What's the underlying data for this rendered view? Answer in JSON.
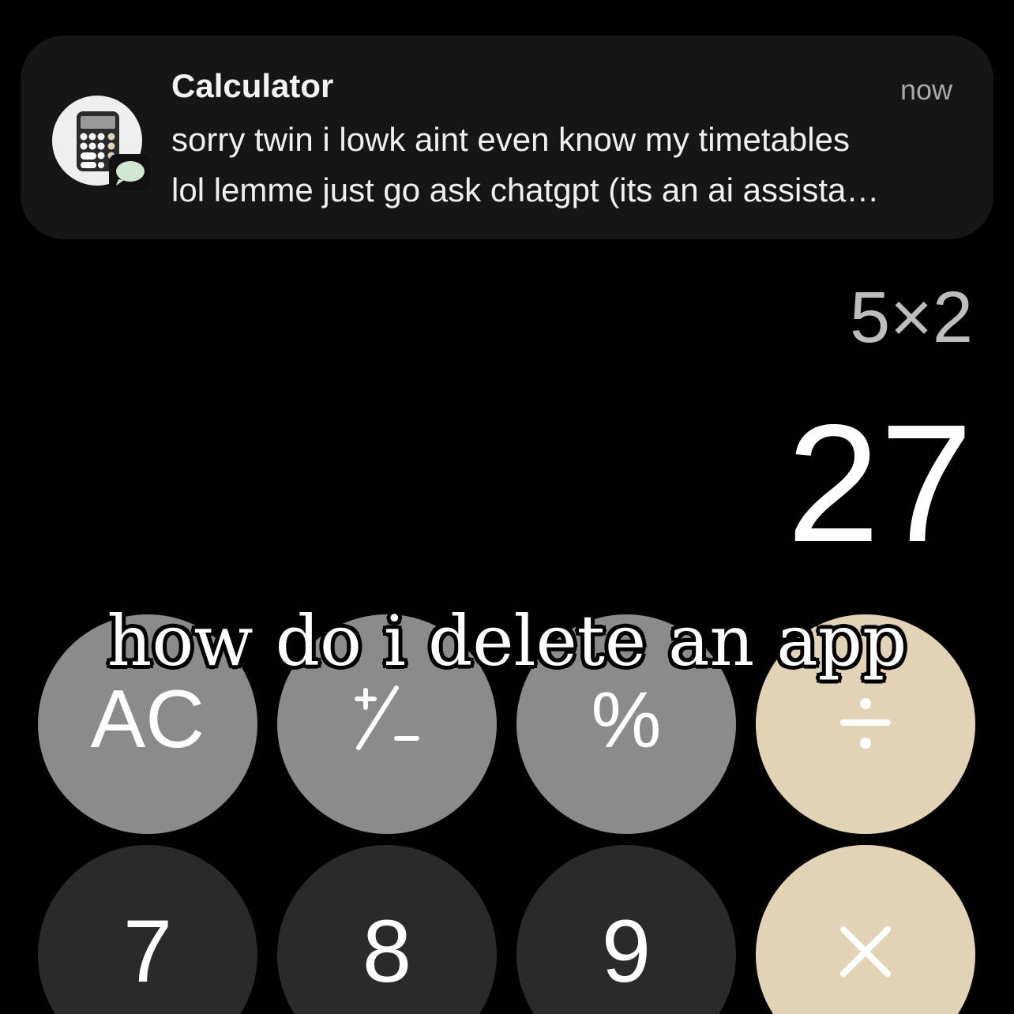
{
  "notification": {
    "app_name": "Calculator",
    "time": "now",
    "message_line1": "sorry twin i lowk aint even know my timetables",
    "message_line2": "lol lemme just go ask chatgpt (its an ai assista…",
    "app_icon": "calculator-icon",
    "badge_icon": "message-bubble-icon"
  },
  "display": {
    "expression": "5×2",
    "result": "27"
  },
  "keypad": {
    "row1": [
      {
        "label": "AC",
        "style": "gray"
      },
      {
        "label": "+/-",
        "style": "gray",
        "icon": "plus-minus-icon"
      },
      {
        "label": "%",
        "style": "gray"
      },
      {
        "label": "÷",
        "style": "op",
        "icon": "divide-icon"
      }
    ],
    "row2": [
      {
        "label": "7",
        "style": "dark"
      },
      {
        "label": "8",
        "style": "dark"
      },
      {
        "label": "9",
        "style": "dark"
      },
      {
        "label": "×",
        "style": "op",
        "icon": "multiply-icon"
      }
    ]
  },
  "caption": "how do i delete an app",
  "colors": {
    "background": "#000000",
    "banner": "#161616",
    "function_key": "#8b8b8b",
    "digit_key": "#2a2a2a",
    "operator_key": "#e2d3b6"
  }
}
